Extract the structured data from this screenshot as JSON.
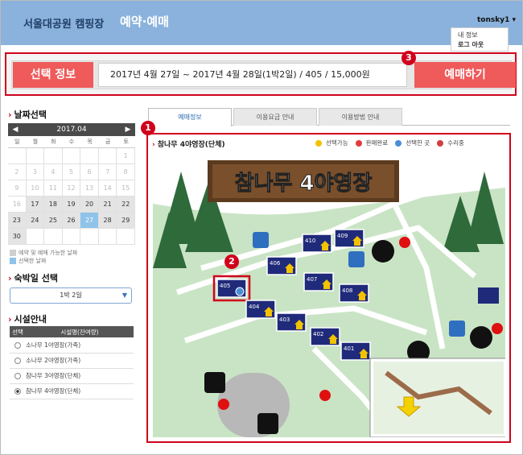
{
  "header": {
    "brand": "서울대공원 캠핑장",
    "nav": "예약·예매",
    "user": "tonsky1 ▾",
    "menu": [
      "내 정보",
      "로그 아웃"
    ]
  },
  "selection": {
    "label": "선택 정보",
    "value": "2017년 4월 27일 ~ 2017년 4월 28일(1박2일) / 405 / 15,000원",
    "button": "예매하기"
  },
  "badges": [
    "1",
    "2",
    "3"
  ],
  "sidebar": {
    "date_title": "날짜선택",
    "calendar": {
      "month": "2017.04",
      "prev": "◀",
      "next": "▶",
      "dow": [
        "일",
        "월",
        "화",
        "수",
        "목",
        "금",
        "토"
      ],
      "weeks": [
        [
          "",
          "",
          "",
          "",
          "",
          "",
          "1"
        ],
        [
          "2",
          "3",
          "4",
          "5",
          "6",
          "7",
          "8"
        ],
        [
          "9",
          "10",
          "11",
          "12",
          "13",
          "14",
          "15"
        ],
        [
          "16",
          "17",
          "18",
          "19",
          "20",
          "21",
          "22"
        ],
        [
          "23",
          "24",
          "25",
          "26",
          "27",
          "28",
          "29"
        ],
        [
          "30",
          "",
          "",
          "",
          "",
          "",
          ""
        ]
      ],
      "available": [
        "17",
        "18",
        "19",
        "20",
        "21",
        "22",
        "23",
        "24",
        "25",
        "26",
        "28",
        "29",
        "30"
      ],
      "selected": "27"
    },
    "legend": [
      "예약 및 예매 가능한 날짜",
      "선택한 날짜"
    ],
    "stay_title": "숙박일 선택",
    "stay_value": "1박 2일",
    "stay_arrow": "▼",
    "facility_title": "시설안내",
    "facility_headers": [
      "선택",
      "시설명(잔여량)"
    ],
    "facilities": [
      {
        "name": "소나무 1야영장(가족)",
        "checked": false
      },
      {
        "name": "소나무 2야영장(가족)",
        "checked": false
      },
      {
        "name": "참나무 3야영장(단체)",
        "checked": false
      },
      {
        "name": "참나무 4야영장(단체)",
        "checked": true
      }
    ]
  },
  "tabs": [
    "예매정보",
    "이용요금 안내",
    "이용방법 안내"
  ],
  "map": {
    "title": "참나무 4야영장(단체)",
    "sign": "참나무 4야영장",
    "legend": [
      {
        "label": "선택가능",
        "color": "#f2c200"
      },
      {
        "label": "판매완료",
        "color": "#e03c3c"
      },
      {
        "label": "선택한 곳",
        "color": "#4a8fd6"
      },
      {
        "label": "수리중",
        "color": "#d04040"
      }
    ],
    "sites": [
      "410",
      "409",
      "406",
      "407",
      "405",
      "408",
      "404",
      "403",
      "402",
      "401"
    ],
    "selected_site": "405"
  },
  "colors": {
    "accent": "#ef5a5a",
    "highlight": "#d0021b",
    "header": "#8ab2dc",
    "grass": "#c9e4c5",
    "site": "#1f2a7a"
  }
}
